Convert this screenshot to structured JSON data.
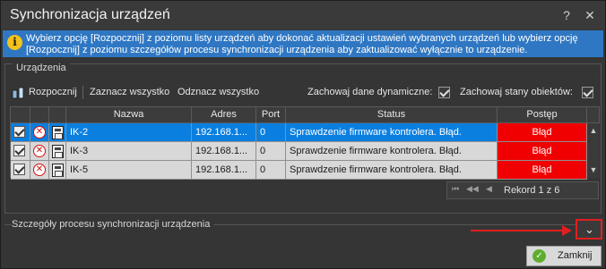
{
  "window": {
    "title": "Synchronizacja urządzeń",
    "help_glyph": "?",
    "close_glyph": "✕"
  },
  "info": {
    "line1": "Wybierz opcję [Rozpocznij] z poziomu listy urządzeń aby dokonać aktualizacji ustawień wybranych urządzeń lub wybierz opcję",
    "line2": "[Rozpocznij] z poziomu szczegółów procesu synchronizacji urządzenia aby zaktualizować wyłącznie to urządzenie."
  },
  "devices_group": {
    "label": "Urządzenia"
  },
  "toolbar": {
    "start_label": "Rozpocznij",
    "select_all_label": "Zaznacz wszystko",
    "deselect_all_label": "Odznacz wszystko",
    "keep_dynamic_label": "Zachowaj dane dynamiczne:",
    "keep_dynamic_checked": true,
    "keep_states_label": "Zachowaj stany obiektów:",
    "keep_states_checked": true
  },
  "grid": {
    "columns": [
      "Nazwa",
      "Adres",
      "Port",
      "Status",
      "Postęp"
    ],
    "rows": [
      {
        "checked": true,
        "name": "IK-2",
        "address": "192.168.1...",
        "port": "0",
        "status": "Sprawdzenie firmware kontrolera. Błąd.",
        "progress": "Błąd",
        "selected": true
      },
      {
        "checked": true,
        "name": "IK-3",
        "address": "192.168.1...",
        "port": "0",
        "status": "Sprawdzenie firmware kontrolera. Błąd.",
        "progress": "Błąd",
        "selected": false
      },
      {
        "checked": true,
        "name": "IK-5",
        "address": "192.168.1...",
        "port": "0",
        "status": "Sprawdzenie firmware kontrolera. Błąd.",
        "progress": "Błąd",
        "selected": false
      }
    ]
  },
  "pager": {
    "text": "Rekord 1 z 6"
  },
  "details": {
    "label": "Szczegóły procesu synchronizacji urządzenia",
    "expand_glyph": "⌄"
  },
  "footer": {
    "close_label": "Zamknij"
  },
  "colors": {
    "accent": "#2f77c3",
    "selected_row": "#0a7fe0",
    "error": "#f00000",
    "highlight": "#e02020"
  }
}
